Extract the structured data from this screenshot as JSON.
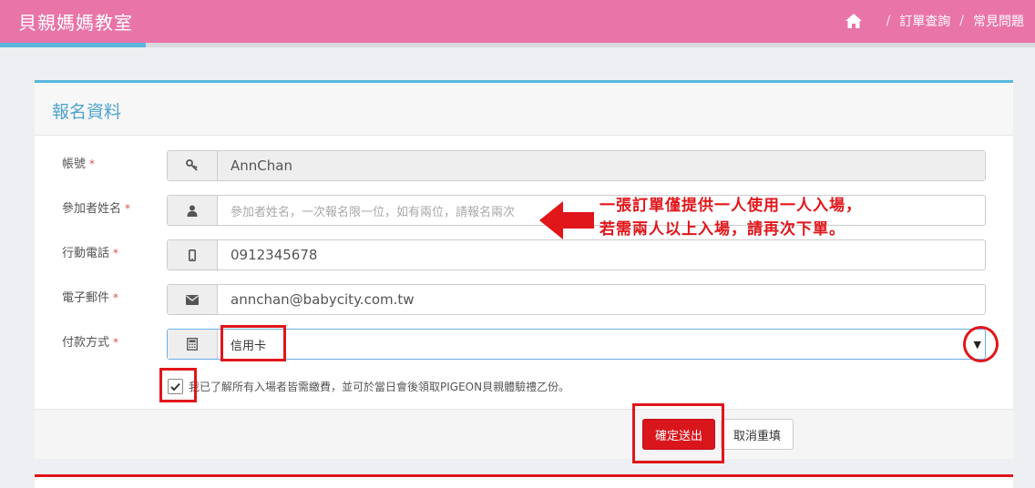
{
  "app": {
    "title": "貝親媽媽教室"
  },
  "nav": {
    "home_icon": "home-icon",
    "sep": "/",
    "items": [
      "訂單查詢",
      "常見問題"
    ]
  },
  "form": {
    "title": "報名資料",
    "fields": {
      "account": {
        "label": "帳號",
        "value": "AnnChan",
        "icon": "key-icon"
      },
      "name": {
        "label": "參加者姓名",
        "placeholder": "參加者姓名，一次報名限一位，如有兩位，請報名兩次",
        "icon": "user-icon"
      },
      "phone": {
        "label": "行動電話",
        "value": "0912345678",
        "icon": "mobile-icon"
      },
      "email": {
        "label": "電子郵件",
        "value": "annchan@babycity.com.tw",
        "icon": "envelope-icon"
      },
      "payment": {
        "label": "付款方式",
        "value": "信用卡",
        "icon": "calculator-icon"
      }
    },
    "required_mark": "*",
    "agree_text": "我已了解所有入場者皆需繳費，並可於當日會後領取PIGEON貝親體驗禮乙份。",
    "submit_label": "確定送出",
    "reset_label": "取消重填"
  },
  "annotation": {
    "line1": "一張訂單僅提供一人使用一人入場，",
    "line2": "若需兩人以上入場，請再次下單。"
  },
  "colors": {
    "topbar": "#e874a8",
    "accent": "#59b7dd",
    "submit": "#d9161c",
    "annotation": "#e0161b"
  }
}
